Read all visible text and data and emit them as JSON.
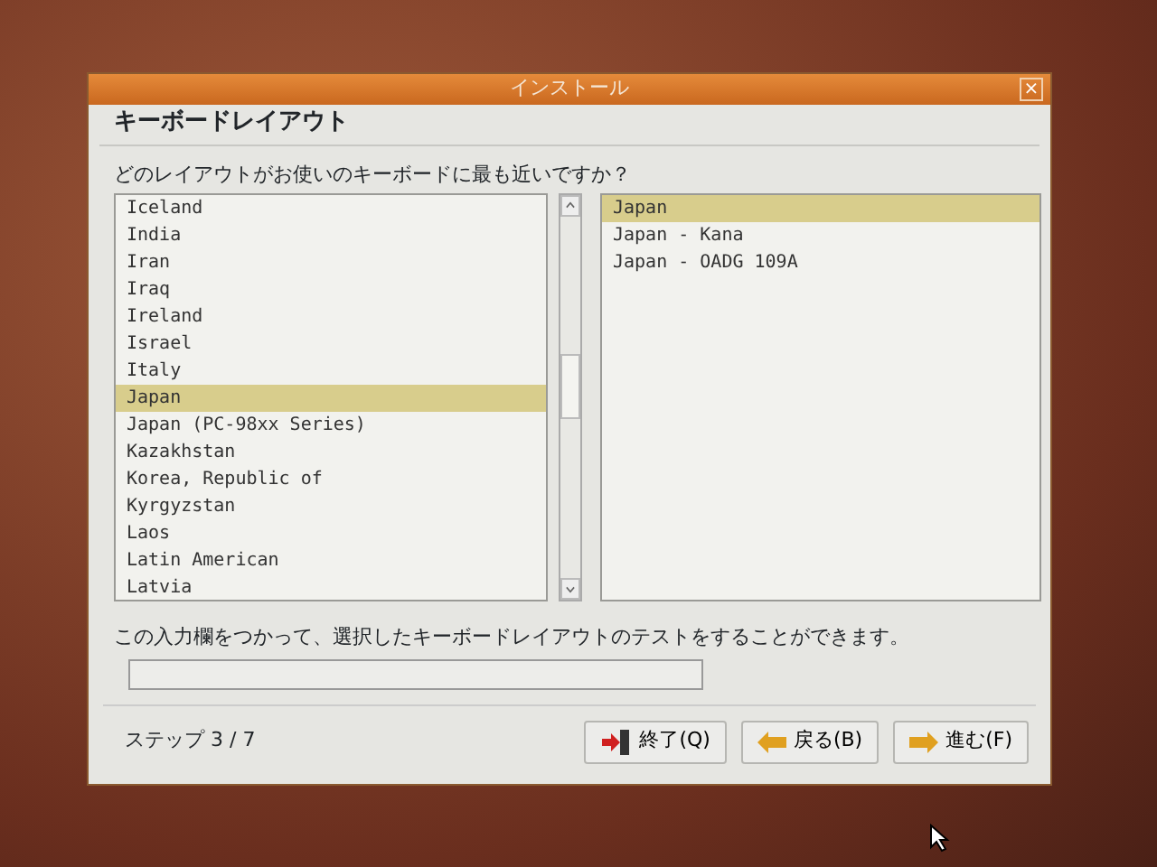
{
  "window": {
    "title": "インストール",
    "close": "×"
  },
  "heading": "キーボードレイアウト",
  "question": "どのレイアウトがお使いのキーボードに最も近いですか？",
  "layouts": [
    {
      "label": "Iceland",
      "selected": false
    },
    {
      "label": "India",
      "selected": false
    },
    {
      "label": "Iran",
      "selected": false
    },
    {
      "label": "Iraq",
      "selected": false
    },
    {
      "label": "Ireland",
      "selected": false
    },
    {
      "label": "Israel",
      "selected": false
    },
    {
      "label": "Italy",
      "selected": false
    },
    {
      "label": "Japan",
      "selected": true
    },
    {
      "label": "Japan (PC-98xx Series)",
      "selected": false
    },
    {
      "label": "Kazakhstan",
      "selected": false
    },
    {
      "label": "Korea, Republic of",
      "selected": false
    },
    {
      "label": "Kyrgyzstan",
      "selected": false
    },
    {
      "label": "Laos",
      "selected": false
    },
    {
      "label": "Latin American",
      "selected": false
    },
    {
      "label": "Latvia",
      "selected": false
    }
  ],
  "variants": [
    {
      "label": "Japan",
      "selected": true
    },
    {
      "label": "Japan - Kana",
      "selected": false
    },
    {
      "label": "Japan - OADG 109A",
      "selected": false
    }
  ],
  "test_hint": "この入力欄をつかって、選択したキーボードレイアウトのテストをすることができます。",
  "step": "ステップ 3 / 7",
  "buttons": [
    {
      "kind": "quit",
      "label": "終了(Q)"
    },
    {
      "kind": "back",
      "label": "戻る(B)"
    },
    {
      "kind": "forward",
      "label": "進む(F)"
    }
  ]
}
